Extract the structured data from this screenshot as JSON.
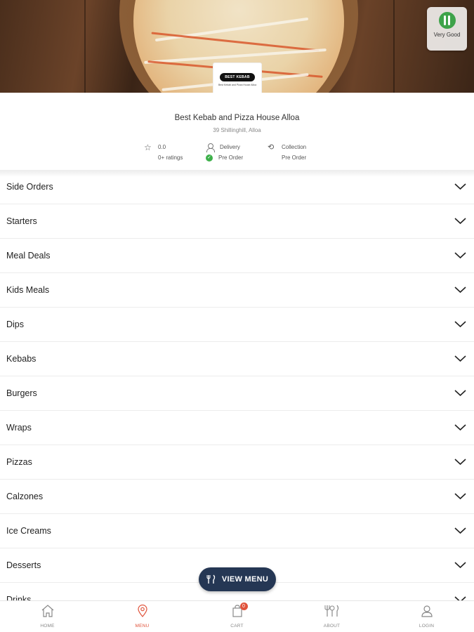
{
  "hero": {
    "rating_badge_label": "Very Good",
    "logo_text": "BEST KEBAB",
    "logo_subtext": "Best Kebab and Pizza House Alloa"
  },
  "restaurant": {
    "name": "Best Kebab and Pizza House Alloa",
    "address": "39 Shillinghill, Alloa",
    "rating_value": "0.0",
    "rating_count": "0+ ratings",
    "delivery_label": "Delivery",
    "delivery_status": "Pre Order",
    "collection_label": "Collection",
    "collection_status": "Pre Order"
  },
  "menu": {
    "categories": [
      "Side Orders",
      "Starters",
      "Meal Deals",
      "Kids Meals",
      "Dips",
      "Kebabs",
      "Burgers",
      "Wraps",
      "Pizzas",
      "Calzones",
      "Ice Creams",
      "Desserts",
      "Drinks"
    ]
  },
  "view_menu_label": "VIEW MENU",
  "nav": {
    "items": [
      {
        "label": "HOME",
        "icon": "home-icon"
      },
      {
        "label": "MENU",
        "icon": "map-pin-icon"
      },
      {
        "label": "CART",
        "icon": "cart-icon"
      },
      {
        "label": "ABOUT",
        "icon": "cutlery-icon"
      },
      {
        "label": "LOGIN",
        "icon": "user-icon"
      }
    ],
    "cart_count": "0",
    "active": "MENU"
  },
  "colors": {
    "accent": "#e0533b",
    "view_menu_bg": "#253754",
    "status_green": "#3db04a"
  }
}
